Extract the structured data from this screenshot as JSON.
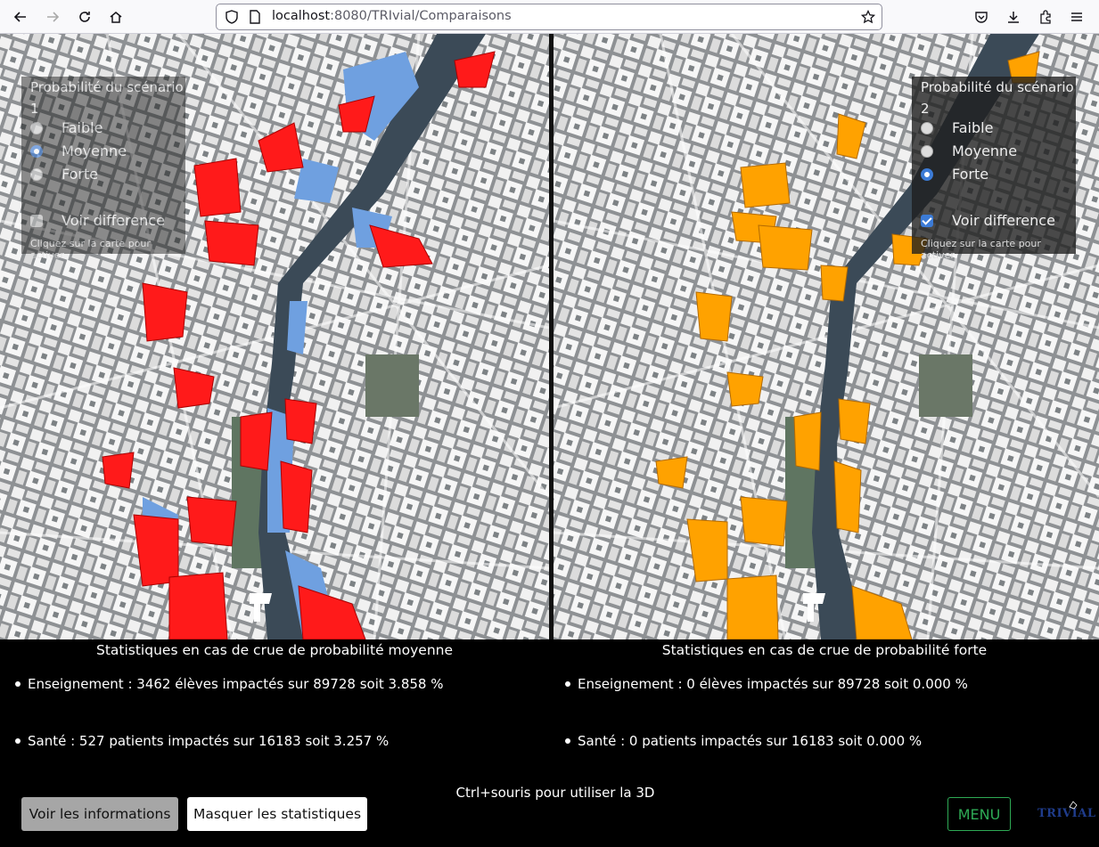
{
  "browser": {
    "url_host": "localhost",
    "url_rest": ":8080/TRIvial/Comparaisons"
  },
  "left_panel": {
    "title": "Probabilité du scénario 1",
    "options": [
      "Faible",
      "Moyenne",
      "Forte"
    ],
    "selected": "Moyenne",
    "diff_label": "Voir difference",
    "diff_checked": false,
    "hint": "Cliquez sur la carte pour activer"
  },
  "right_panel": {
    "title": "Probabilité du scénario 2",
    "options": [
      "Faible",
      "Moyenne",
      "Forte"
    ],
    "selected": "Forte",
    "diff_label": "Voir difference",
    "diff_checked": true,
    "hint": "Cliquez sur la carte pour activer"
  },
  "left_stats": {
    "title": "Statistiques en cas de crue de probabilité moyenne",
    "items": [
      "Enseignement : 3462 élèves impactés sur 89728 soit 3.858 %",
      "Santé : 527 patients impactés sur 16183 soit 3.257 %"
    ]
  },
  "right_stats": {
    "title": "Statistiques en cas de crue de probabilité forte",
    "items": [
      "Enseignement : 0 élèves impactés sur 89728 soit 0.000 %",
      "Santé : 0 patients impactés sur 16183 soit 0.000 %"
    ]
  },
  "footer": {
    "hint_3d": "Ctrl+souris pour utiliser la 3D",
    "info_button": "Voir les informations",
    "stats_button": "Masquer les statistiques",
    "menu_button": "MENU",
    "logo_text": "TRIVIAL"
  },
  "colors": {
    "left_flood": "#ff1a1a",
    "left_water": "#6fa0e0",
    "right_flood": "#ffa200",
    "river": "#3b4a57",
    "accent": "#3c7bd6",
    "menu": "#2eaa55"
  }
}
